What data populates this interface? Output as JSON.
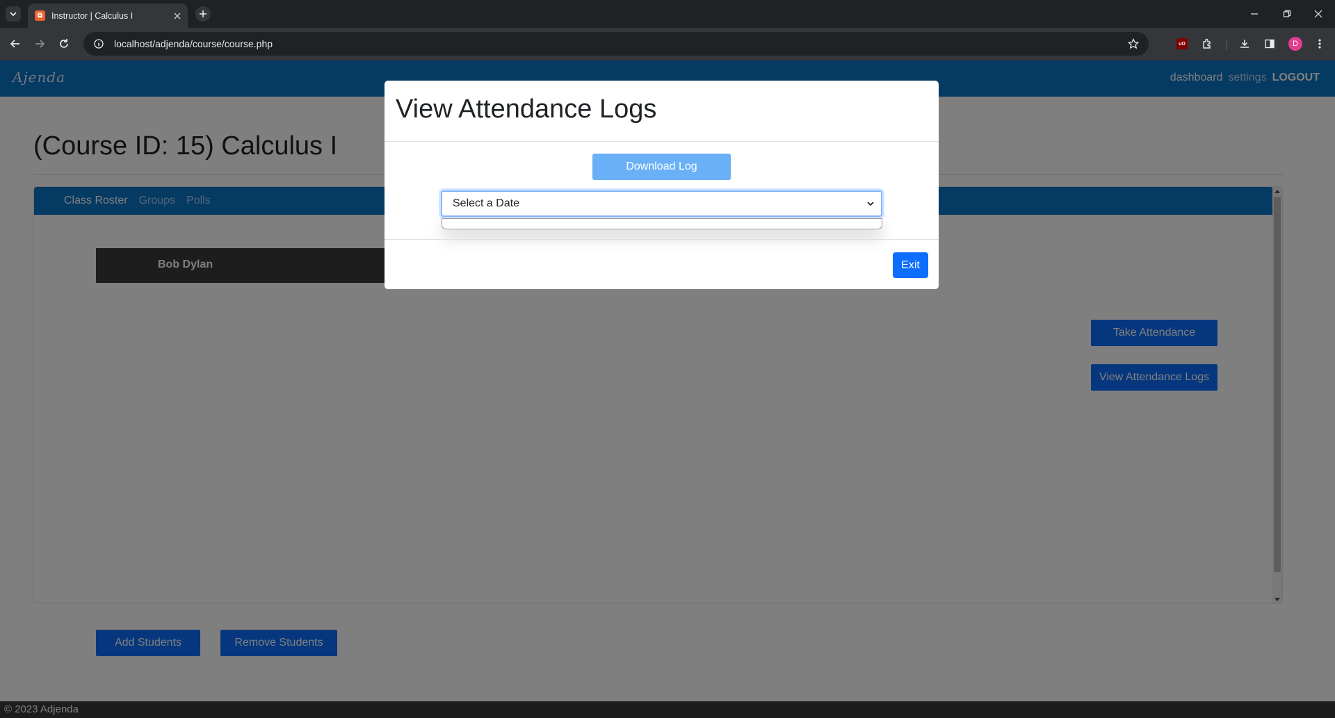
{
  "browser": {
    "tab_title": "Instructor | Calculus I",
    "favicon_text": "⧉",
    "url": "localhost/adjenda/course/course.php",
    "profile_initial": "D",
    "ublock_text": "uO",
    "icons": [
      "tab-list-icon",
      "close-icon",
      "plus-icon",
      "minimize-icon",
      "restore-icon",
      "close-window-icon",
      "back-icon",
      "forward-icon",
      "reload-icon",
      "site-info-icon",
      "star-icon",
      "extensions-icon",
      "download-icon",
      "side-panel-icon",
      "more-icon"
    ]
  },
  "header": {
    "logo": "Ajenda",
    "nav": {
      "dashboard": "dashboard",
      "settings": "settings",
      "logout": "LOGOUT"
    }
  },
  "course": {
    "title": "(Course ID: 15) Calculus I",
    "tabs": [
      "Class Roster",
      "Groups",
      "Polls"
    ],
    "students": [
      "Bob Dylan"
    ],
    "buttons": {
      "take_attendance": "Take Attendance",
      "view_logs": "View Attendance Logs",
      "add_students": "Add Students",
      "remove_students": "Remove Students"
    }
  },
  "footer": {
    "text": "© 2023 Adjenda"
  },
  "modal": {
    "title": "View Attendance Logs",
    "download_label": "Download Log",
    "select_value": "Select a Date",
    "exit_label": "Exit"
  },
  "colors": {
    "header_blue": "#0a75c6",
    "button_blue": "#0d6efd",
    "download_light_blue": "#6ab0f7",
    "student_row": "#3a3a3a"
  }
}
